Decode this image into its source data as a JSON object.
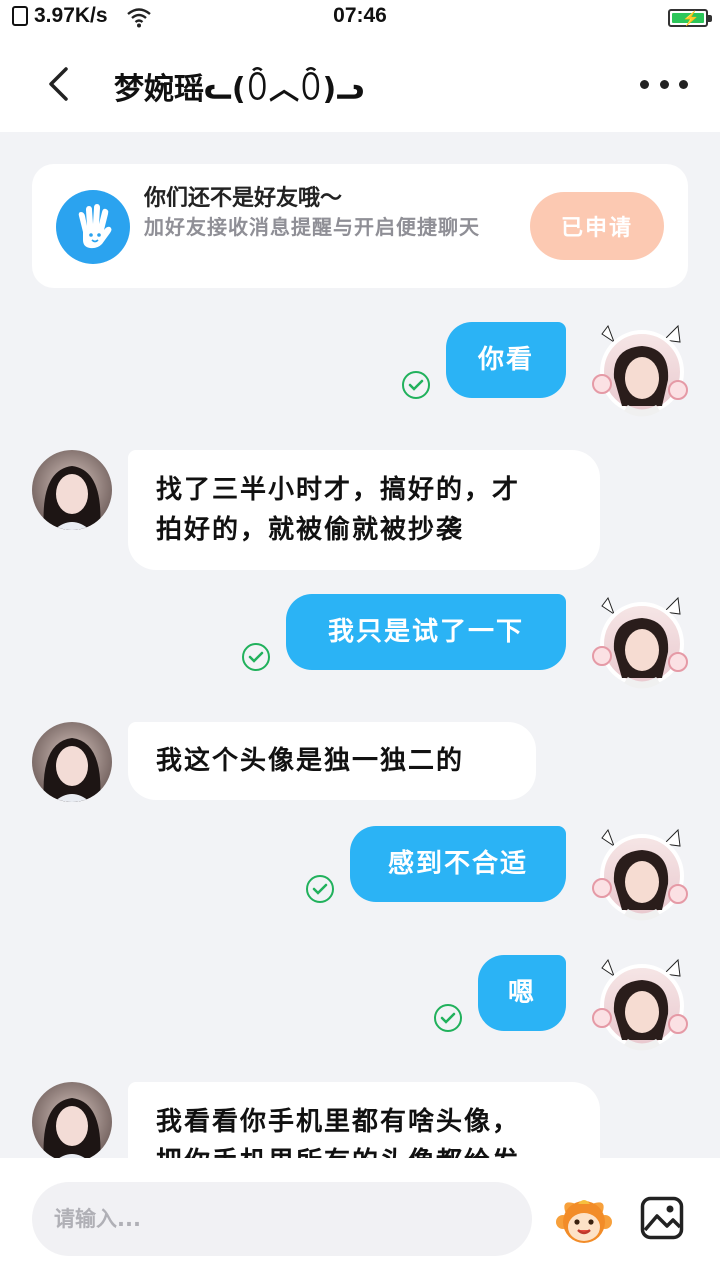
{
  "status_bar": {
    "speed": "3.97K/s",
    "time": "07:46"
  },
  "header": {
    "title": "梦婉瑶ᓚ(ꄱ︿ꄱ)ᓗ"
  },
  "notice": {
    "title": "你们还不是好友哦～",
    "subtitle": "加好友接收消息提醒与开启便捷聊天",
    "button_label": "已申请"
  },
  "messages": [
    {
      "side": "out",
      "text": "你看"
    },
    {
      "side": "in",
      "lines": [
        "找了三半小时才，搞好的，才",
        "拍好的，就被偷就被抄袭"
      ]
    },
    {
      "side": "out",
      "text": "我只是试了一下"
    },
    {
      "side": "in",
      "text": "我这个头像是独一独二的"
    },
    {
      "side": "out",
      "text": "感到不合适"
    },
    {
      "side": "out",
      "text": "嗯"
    },
    {
      "side": "in",
      "lines": [
        "我看看你手机里都有啥头像，",
        "把你手机里所有的头像都给发"
      ]
    }
  ],
  "input": {
    "placeholder": "请输入..."
  },
  "colors": {
    "accent": "#2bb3f5",
    "read_check": "#21b15c",
    "applied_button": "#fcc9b2"
  }
}
